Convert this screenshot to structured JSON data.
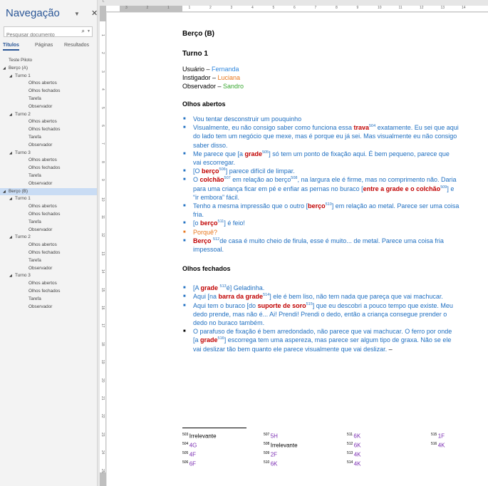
{
  "nav": {
    "title": "Navegação",
    "search_placeholder": "Pesquisar documento",
    "tabs": [
      "Títulos",
      "Páginas",
      "Resultados"
    ],
    "tree": [
      {
        "label": "Teste Piloto",
        "level": 0,
        "expanded": false,
        "selected": false
      },
      {
        "label": "Berço (A)",
        "level": 0,
        "expanded": true,
        "selected": false
      },
      {
        "label": "Turno 1",
        "level": 1,
        "expanded": true,
        "selected": false
      },
      {
        "label": "Olhos abertos",
        "level": 2,
        "expanded": false,
        "selected": false
      },
      {
        "label": "Olhos fechados",
        "level": 2,
        "expanded": false,
        "selected": false
      },
      {
        "label": "Tarefa",
        "level": 2,
        "expanded": false,
        "selected": false
      },
      {
        "label": "Observador",
        "level": 2,
        "expanded": false,
        "selected": false
      },
      {
        "label": "Turno 2",
        "level": 1,
        "expanded": true,
        "selected": false
      },
      {
        "label": "Olhos abertos",
        "level": 2,
        "expanded": false,
        "selected": false
      },
      {
        "label": "Olhos fechados",
        "level": 2,
        "expanded": false,
        "selected": false
      },
      {
        "label": "Tarefa",
        "level": 2,
        "expanded": false,
        "selected": false
      },
      {
        "label": "Observador",
        "level": 2,
        "expanded": false,
        "selected": false
      },
      {
        "label": "Turno 3",
        "level": 1,
        "expanded": true,
        "selected": false
      },
      {
        "label": "Olhos abertos",
        "level": 2,
        "expanded": false,
        "selected": false
      },
      {
        "label": "Olhos fechados",
        "level": 2,
        "expanded": false,
        "selected": false
      },
      {
        "label": "Tarefa",
        "level": 2,
        "expanded": false,
        "selected": false
      },
      {
        "label": "Observador",
        "level": 2,
        "expanded": false,
        "selected": false
      },
      {
        "label": "Berço (B)",
        "level": 0,
        "expanded": true,
        "selected": true
      },
      {
        "label": "Turno 1",
        "level": 1,
        "expanded": true,
        "selected": false
      },
      {
        "label": "Olhos abertos",
        "level": 2,
        "expanded": false,
        "selected": false
      },
      {
        "label": "Olhos fechados",
        "level": 2,
        "expanded": false,
        "selected": false
      },
      {
        "label": "Tarefa",
        "level": 2,
        "expanded": false,
        "selected": false
      },
      {
        "label": "Observador",
        "level": 2,
        "expanded": false,
        "selected": false
      },
      {
        "label": "Turno 2",
        "level": 1,
        "expanded": true,
        "selected": false
      },
      {
        "label": "Olhos abertos",
        "level": 2,
        "expanded": false,
        "selected": false
      },
      {
        "label": "Olhos fechados",
        "level": 2,
        "expanded": false,
        "selected": false
      },
      {
        "label": "Tarefa",
        "level": 2,
        "expanded": false,
        "selected": false
      },
      {
        "label": "Observador",
        "level": 2,
        "expanded": false,
        "selected": false
      },
      {
        "label": "Turno 3",
        "level": 1,
        "expanded": true,
        "selected": false
      },
      {
        "label": "Olhos abertos",
        "level": 2,
        "expanded": false,
        "selected": false
      },
      {
        "label": "Olhos fechados",
        "level": 2,
        "expanded": false,
        "selected": false
      },
      {
        "label": "Tarefa",
        "level": 2,
        "expanded": false,
        "selected": false
      },
      {
        "label": "Observador",
        "level": 2,
        "expanded": false,
        "selected": false
      }
    ]
  },
  "ruler": {
    "h_ticks": [
      "3",
      "2",
      "1",
      "1",
      "2",
      "3",
      "4",
      "5",
      "6",
      "7",
      "8",
      "9",
      "10",
      "11",
      "12",
      "13",
      "14"
    ],
    "v_ticks": [
      "1",
      "2",
      "3",
      "4",
      "5",
      "6",
      "7",
      "8",
      "9",
      "10",
      "11",
      "12",
      "13",
      "14",
      "15",
      "16",
      "17",
      "18",
      "19",
      "20",
      "21",
      "22",
      "23",
      "24",
      "25"
    ]
  },
  "doc": {
    "title": "Berço (B)",
    "turn": "Turno 1",
    "roles": [
      {
        "label": "Usuário – ",
        "name": "Fernanda",
        "color": "#2e86de"
      },
      {
        "label": "Instigador – ",
        "name": "Luciana",
        "color": "#e8761c"
      },
      {
        "label": "Observador – ",
        "name": "Sandro",
        "color": "#3aa832"
      }
    ],
    "sec1": "Olhos abertos",
    "sec2": "Olhos fechados",
    "colors": {
      "blue": "#1f6fc1",
      "red": "#c00000",
      "orange": "#e8761c",
      "purple": "#7b2fb3"
    },
    "footnotes": [
      [
        {
          "n": "503",
          "v": "Irrelevante",
          "blk": true
        },
        {
          "n": "504",
          "v": "4G"
        },
        {
          "n": "505",
          "v": "4F"
        },
        {
          "n": "506",
          "v": "6F"
        }
      ],
      [
        {
          "n": "507",
          "v": "5H"
        },
        {
          "n": "508",
          "v": "Irrelevante",
          "blk": true
        },
        {
          "n": "509",
          "v": "2F"
        },
        {
          "n": "510",
          "v": "6K"
        }
      ],
      [
        {
          "n": "511",
          "v": "6K"
        },
        {
          "n": "512",
          "v": "6K"
        },
        {
          "n": "513",
          "v": "4K"
        },
        {
          "n": "514",
          "v": "4K"
        }
      ],
      [
        {
          "n": "515",
          "v": "1F"
        },
        {
          "n": "516",
          "v": "4K"
        }
      ]
    ]
  }
}
